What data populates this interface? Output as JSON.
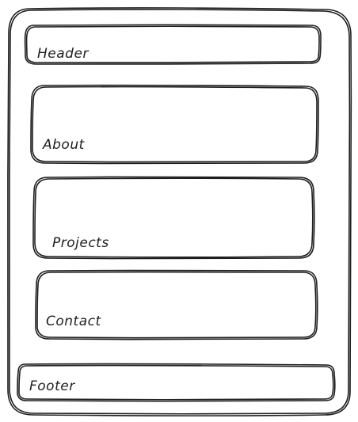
{
  "wireframe": {
    "sections": {
      "header": "Header",
      "about": "About",
      "projects": "Projects",
      "contact": "Contact",
      "footer": "Footer"
    }
  }
}
